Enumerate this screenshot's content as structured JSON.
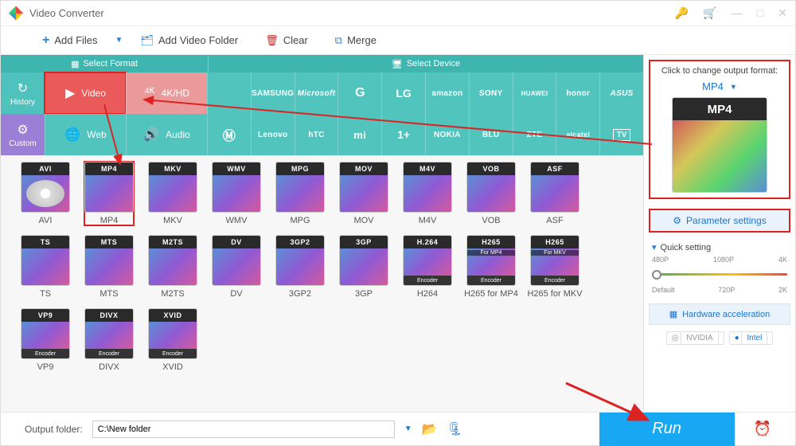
{
  "app": {
    "title": "Video Converter"
  },
  "toolbar": {
    "add": "Add Files",
    "folder": "Add Video Folder",
    "clear": "Clear",
    "merge": "Merge"
  },
  "headers": {
    "format": "Select Format",
    "device": "Select Device"
  },
  "side": {
    "history": "History",
    "custom": "Custom"
  },
  "cats": {
    "video": "Video",
    "hd": "4K/HD",
    "web": "Web",
    "audio": "Audio"
  },
  "devices_row1": [
    "",
    "SAMSUNG",
    "Microsoft",
    "G",
    "LG",
    "amazon",
    "SONY",
    "HUAWEI",
    "honor",
    "ASUS"
  ],
  "devices_row2": [
    "",
    "Lenovo",
    "hTC",
    "mi",
    "",
    "NOKIA",
    "BLU",
    "ZTE",
    "alcatel",
    "TV"
  ],
  "formats": [
    {
      "tag": "AVI",
      "label": "AVI",
      "disc": true
    },
    {
      "tag": "MP4",
      "label": "MP4",
      "sel": true
    },
    {
      "tag": "MKV",
      "label": "MKV"
    },
    {
      "tag": "WMV",
      "label": "WMV"
    },
    {
      "tag": "MPG",
      "label": "MPG"
    },
    {
      "tag": "MOV",
      "label": "MOV"
    },
    {
      "tag": "M4V",
      "label": "M4V"
    },
    {
      "tag": "VOB",
      "label": "VOB"
    },
    {
      "tag": "ASF",
      "label": "ASF"
    },
    {
      "tag": "TS",
      "label": "TS"
    },
    {
      "tag": "MTS",
      "label": "MTS"
    },
    {
      "tag": "M2TS",
      "label": "M2TS"
    },
    {
      "tag": "DV",
      "label": "DV"
    },
    {
      "tag": "3GP2",
      "label": "3GP2"
    },
    {
      "tag": "3GP",
      "label": "3GP"
    },
    {
      "tag": "H.264",
      "label": "H264",
      "enc": "Encoder"
    },
    {
      "tag": "H265",
      "label": "H265 for MP4",
      "enc": "Encoder",
      "sub": "For MP4"
    },
    {
      "tag": "H265",
      "label": "H265 for MKV",
      "enc": "Encoder",
      "sub": "For MKV"
    },
    {
      "tag": "VP9",
      "label": "VP9",
      "enc": "Encoder"
    },
    {
      "tag": "DIVX",
      "label": "DIVX",
      "enc": "Encoder"
    },
    {
      "tag": "XVID",
      "label": "XVID",
      "enc": "Encoder"
    }
  ],
  "right": {
    "hint": "Click to change output format:",
    "selected": "MP4",
    "param": "Parameter settings",
    "quick": "Quick setting",
    "marks_top": [
      "480P",
      "1080P",
      "4K"
    ],
    "marks_bot": [
      "Default",
      "720P",
      "2K"
    ],
    "hw": "Hardware acceleration",
    "gpu1": "NVIDIA",
    "gpu2": "Intel"
  },
  "bottom": {
    "label": "Output folder:",
    "path": "C:\\New folder",
    "run": "Run"
  }
}
